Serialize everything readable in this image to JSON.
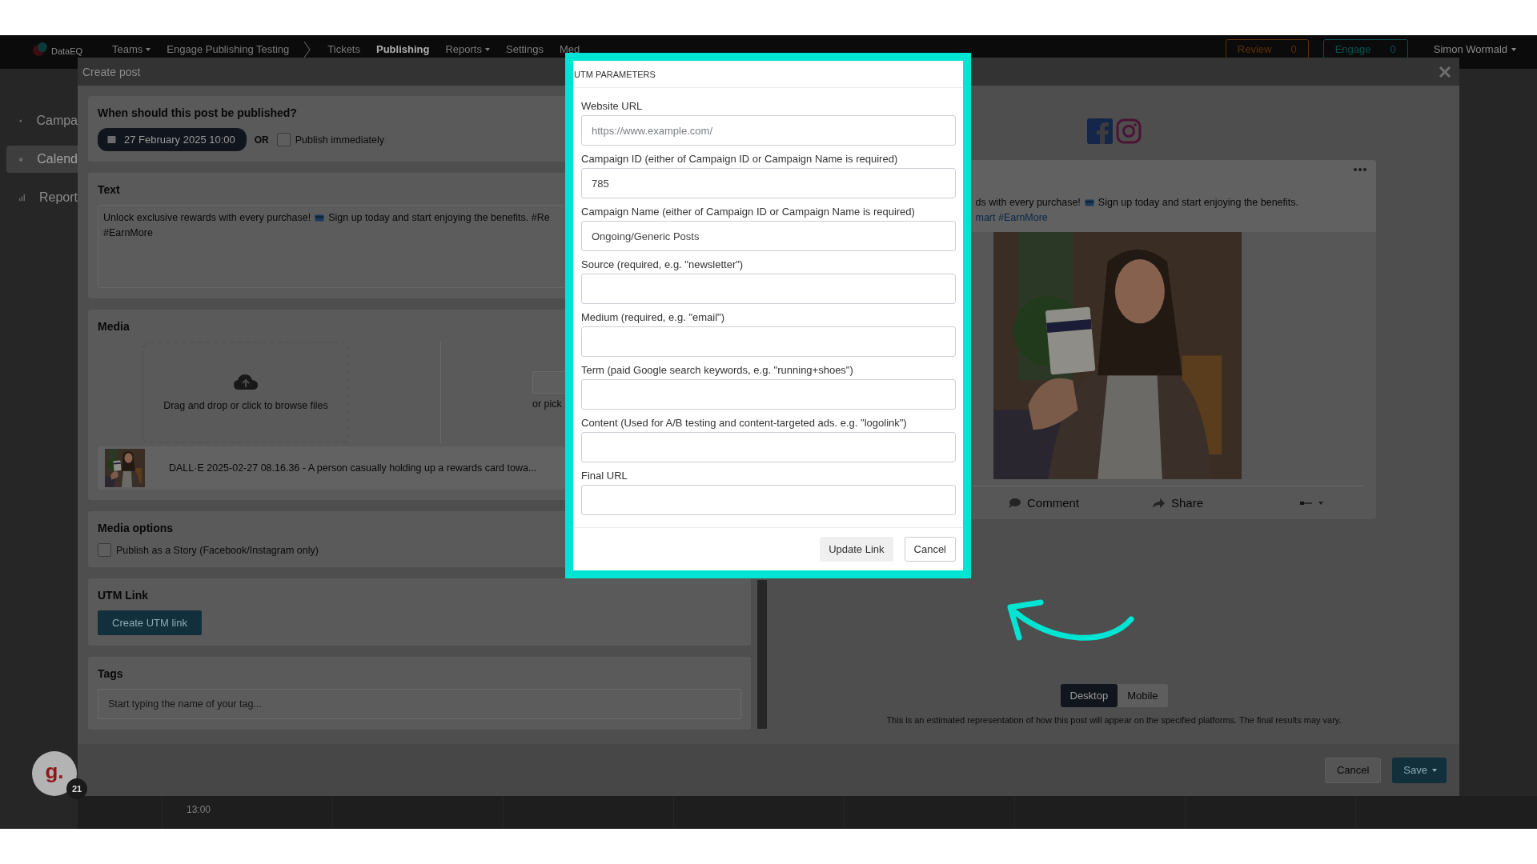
{
  "navbar": {
    "brand": "DataEQ",
    "items": [
      {
        "label": "Teams",
        "dropdown": true,
        "divider": false,
        "selected": false
      },
      {
        "label": "Engage Publishing Testing",
        "dropdown": false,
        "divider": true,
        "selected": false
      },
      {
        "label": "Tickets",
        "dropdown": false,
        "divider": false,
        "selected": false
      },
      {
        "label": "Publishing",
        "dropdown": false,
        "divider": false,
        "selected": true
      },
      {
        "label": "Reports",
        "dropdown": true,
        "divider": false,
        "selected": false
      },
      {
        "label": "Settings",
        "dropdown": false,
        "divider": false,
        "selected": false
      },
      {
        "label": "Med",
        "dropdown": false,
        "divider": false,
        "selected": false
      }
    ],
    "counters": [
      {
        "label": "Review",
        "count": "0",
        "color": "#5c3008"
      },
      {
        "label": "Engage",
        "count": "0",
        "color": "#0b4f50"
      }
    ],
    "user": "Simon Wormald"
  },
  "sidebar": {
    "items": [
      {
        "label": "Campa",
        "selected": false
      },
      {
        "label": "Calend",
        "selected": true
      },
      {
        "label": "Report",
        "selected": false
      }
    ]
  },
  "calendar": {
    "time": "13:00"
  },
  "create_post": {
    "title": "Create post",
    "schedule": {
      "heading": "When should this post be published?",
      "date": "27 February 2025 10:00",
      "or": "OR",
      "immediate": {
        "label": "Publish immediately",
        "checked": false
      }
    },
    "text": {
      "heading": "Text",
      "lines": [
        {
          "before_card": "Unlock exclusive rewards with every purchase!",
          "after_card": "Sign up today and start enjoying the benefits. #Re"
        },
        {
          "before_card": "#EarnMore"
        }
      ]
    },
    "media": {
      "heading": "Media",
      "dropzone": "Drag and drop or click to browse files",
      "pick": "or pick",
      "files": [
        {
          "kind": "picture",
          "name": "DALL·E 2025-02-27 08.16.36 - A person casually holding up a rewards card towa..."
        }
      ]
    },
    "media_options": {
      "heading": "Media options",
      "options": [
        {
          "label": "Publish as a Story (Facebook/Instagram only)",
          "checked": false
        }
      ]
    },
    "utm": {
      "heading": "UTM Link",
      "button": "Create UTM link"
    },
    "tags": {
      "heading": "Tags",
      "placeholder": "Start typing the name of your tag..."
    },
    "preview": {
      "text": [
        {
          "before_card": "ds with every purchase!",
          "after_card": "Sign up today and start enjoying the benefits."
        }
      ],
      "hashtags": "mart #EarnMore",
      "image": {
        "kind": "picture"
      },
      "actions": [
        "Comment",
        "Share"
      ],
      "views": [
        {
          "label": "Desktop",
          "selected": true
        },
        {
          "label": "Mobile",
          "selected": false
        }
      ],
      "disclaimer": "This is an estimated representation of how this post will appear on the specified platforms. The final results may vary."
    },
    "footer": {
      "cancel": "Cancel",
      "save": "Save"
    }
  },
  "utm_dialog": {
    "title": "UTM PARAMETERS",
    "fields": [
      {
        "label": "Website URL",
        "placeholder": "https://www.example.com/"
      },
      {
        "label": "Campaign ID (either of Campaign ID or Campaign Name is required)",
        "value": "785"
      },
      {
        "label": "Campaign Name (either of Campaign ID or Campaign Name is required)",
        "value": "Ongoing/Generic Posts"
      },
      {
        "label": "Source (required, e.g. \"newsletter\")"
      },
      {
        "label": "Medium (required, e.g. \"email\")"
      },
      {
        "label": "Term (paid Google search keywords, e.g. \"running+shoes\")"
      },
      {
        "label": "Content (Used for A/B testing and content-targeted ads. e.g. \"logolink\")"
      },
      {
        "label": "Final URL"
      }
    ],
    "buttons": [
      {
        "label": "Update Link",
        "kind": "primary"
      },
      {
        "label": "Cancel",
        "kind": "outline"
      }
    ]
  },
  "chat": {
    "logo": "g.",
    "badge": "21"
  }
}
